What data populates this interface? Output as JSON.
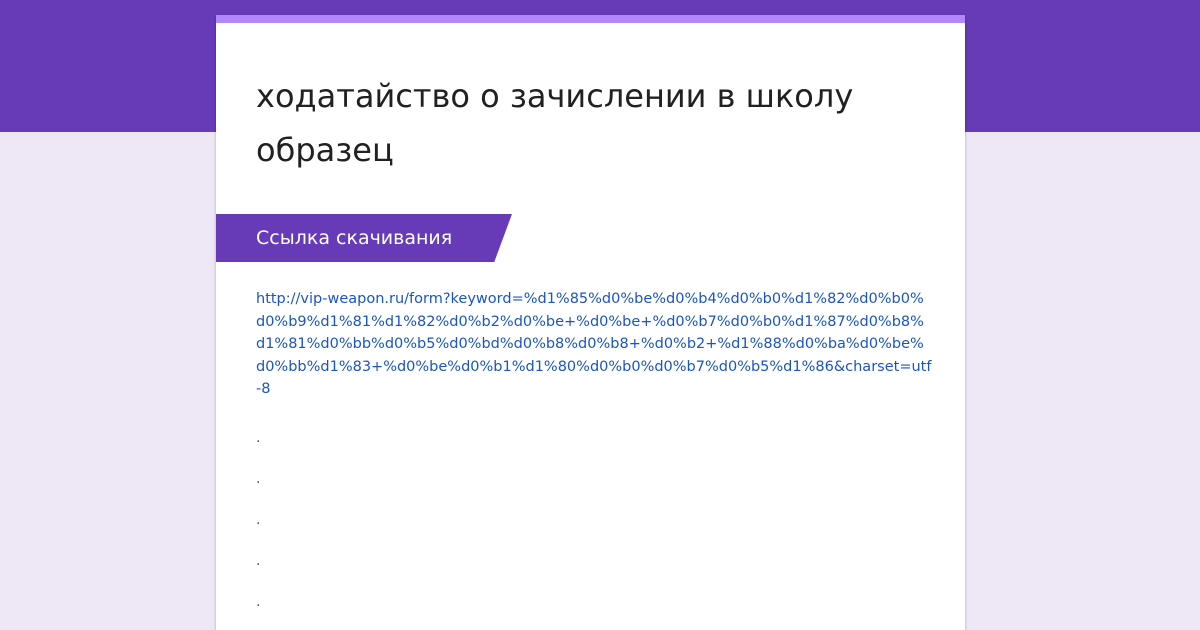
{
  "form": {
    "title": "ходатайство о зачислении в школу образец",
    "section_title": "Ссылка скачивания",
    "download_link": "http://vip-weapon.ru/form?keyword=%d1%85%d0%be%d0%b4%d0%b0%d1%82%d0%b0%d0%b9%d1%81%d1%82%d0%b2%d0%be+%d0%be+%d0%b7%d0%b0%d1%87%d0%b8%d1%81%d0%bb%d0%b5%d0%bd%d0%b8%d0%b8+%d0%b2+%d1%88%d0%ba%d0%be%d0%bb%d1%83+%d0%be%d0%b1%d1%80%d0%b0%d0%b7%d0%b5%d1%86&charset=utf-8",
    "dots": [
      ".",
      ".",
      ".",
      ".",
      "."
    ]
  },
  "colors": {
    "header_band": "#673ab7",
    "page_background": "#ede7f6",
    "card_accent": "#b388ff",
    "link": "#1a55c5"
  }
}
